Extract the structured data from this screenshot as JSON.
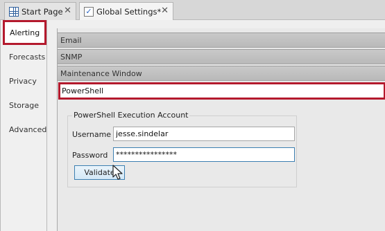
{
  "tabs": [
    {
      "label": "Start Page",
      "icon": "grid-icon",
      "close": "✕"
    },
    {
      "label": "Global Settings*",
      "icon": "checklist-icon",
      "close": "✕"
    }
  ],
  "sidebar": {
    "items": [
      {
        "label": "Alerting"
      },
      {
        "label": "Forecasts"
      },
      {
        "label": "Privacy"
      },
      {
        "label": "Storage"
      },
      {
        "label": "Advanced"
      }
    ],
    "active_index": 0
  },
  "sections": [
    {
      "label": "Email"
    },
    {
      "label": "SNMP"
    },
    {
      "label": "Maintenance Window"
    },
    {
      "label": "PowerShell"
    }
  ],
  "powershell": {
    "group_title": "PowerShell Execution Account",
    "username_label": "Username",
    "username_value": "jesse.sindelar",
    "password_label": "Password",
    "password_value": "****************",
    "validate_label": "Validate"
  },
  "colors": {
    "highlight": "#b4192d",
    "focus_border": "#3c7fb1"
  }
}
